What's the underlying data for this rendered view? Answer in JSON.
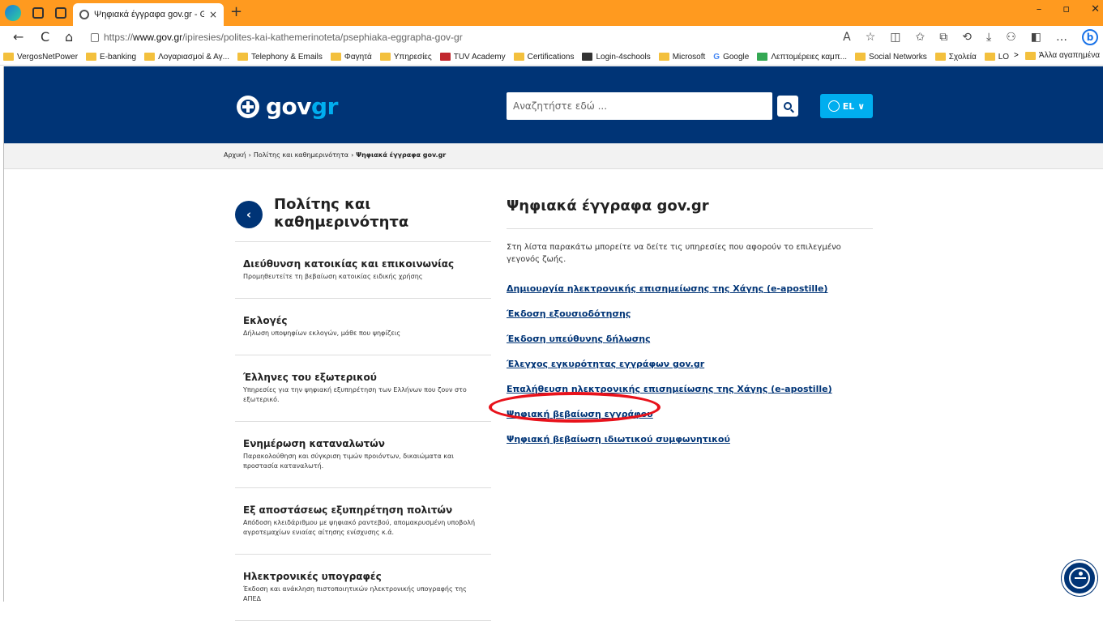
{
  "browser": {
    "tab_title": "Ψηφιακά έγγραφα gov.gr - Gov.",
    "tab_close": "×",
    "new_tab": "+",
    "url_prefix": "https://",
    "url_host": "www.gov.gr",
    "url_path": "/ipiresies/polites-kai-kathemerinoteta/psephiaka-eggrapha-gov-gr",
    "controls": {
      "minimize": "–",
      "maximize": "▫",
      "close": "✕"
    },
    "nav": {
      "back": "←",
      "reload": "C",
      "home": "⌂"
    },
    "toolbar_icons": [
      "A",
      "☆",
      "◫",
      "✩",
      "⧉",
      "⟲",
      "⤓",
      "⚇",
      "◧",
      "…"
    ],
    "bing": "b",
    "bookmarks": [
      "VergosNetPower",
      "E-banking",
      "Λογαριασμοί & Αγ...",
      "Telephony & Emails",
      "Φαγητά",
      "Υπηρεσίες",
      "TUV Academy",
      "Certifications",
      "Login-4schools",
      "Microsoft",
      "Google",
      "Λεπτομέρειες καμπ...",
      "Social Networks",
      "Σχολεία",
      "LOVE PDF"
    ],
    "bookmarks_more": ">",
    "other_favorites": "Άλλα αγαπημένα"
  },
  "header": {
    "logo_gov": "gov",
    "logo_gr": "gr",
    "search_placeholder": "Αναζητήστε εδώ ...",
    "lang": "EL",
    "lang_chevron": "∨"
  },
  "breadcrumb": {
    "items": [
      "Αρχική",
      "Πολίτης και καθημερινότητα"
    ],
    "separator": "›",
    "current": "Ψηφιακά έγγραφα gov.gr"
  },
  "sidebar": {
    "back_symbol": "‹",
    "title": "Πολίτης και καθημερινότητα",
    "items": [
      {
        "title": "Διεύθυνση κατοικίας και επικοινωνίας",
        "desc": "Προμηθευτείτε τη βεβαίωση κατοικίας ειδικής χρήσης"
      },
      {
        "title": "Εκλογές",
        "desc": "Δήλωση υποψηφίων εκλογών, μάθε που ψηφίζεις"
      },
      {
        "title": "Έλληνες του εξωτερικού",
        "desc": "Υπηρεσίες για την ψηφιακή εξυπηρέτηση των Ελλήνων που ζουν στο εξωτερικό."
      },
      {
        "title": "Ενημέρωση καταναλωτών",
        "desc": "Παρακολούθηση και σύγκριση τιμών προιόντων, δικαιώματα και προστασία καταναλωτή."
      },
      {
        "title": "Εξ αποστάσεως εξυπηρέτηση πολιτών",
        "desc": "Απόδοση κλειδάριθμου με ψηφιακό ραντεβού, απομακρυσμένη υποβολή αγροτεμαχίων ενιαίας αίτησης ενίσχυσης κ.ά."
      },
      {
        "title": "Ηλεκτρονικές υπογραφές",
        "desc": "Έκδοση και ανάκληση πιστοποιητικών ηλεκτρονικής υπογραφής της ΑΠΕΔ"
      }
    ]
  },
  "main": {
    "title": "Ψηφιακά έγγραφα gov.gr",
    "intro": "Στη λίστα παρακάτω μπορείτε να δείτε τις υπηρεσίες που αφορούν το επιλεγμένο γεγονός ζωής.",
    "links": [
      "Δημιουργία ηλεκτρονικής επισημείωσης της Χάγης (e-apostille)",
      "Έκδοση εξουσιοδότησης",
      "Έκδοση υπεύθυνης δήλωσης",
      "Έλεγχος εγκυρότητας εγγράφων gov.gr",
      "Επαλήθευση ηλεκτρονικής επισημείωσης της Χάγης (e-apostille)",
      "Ψηφιακή βεβαίωση εγγράφου",
      "Ψηφιακή βεβαίωση ιδιωτικού συμφωνητικού"
    ]
  },
  "colors": {
    "titlebar": "#ff9a1f",
    "header": "#003476",
    "accent": "#00aeef",
    "highlight": "#e8121b"
  }
}
